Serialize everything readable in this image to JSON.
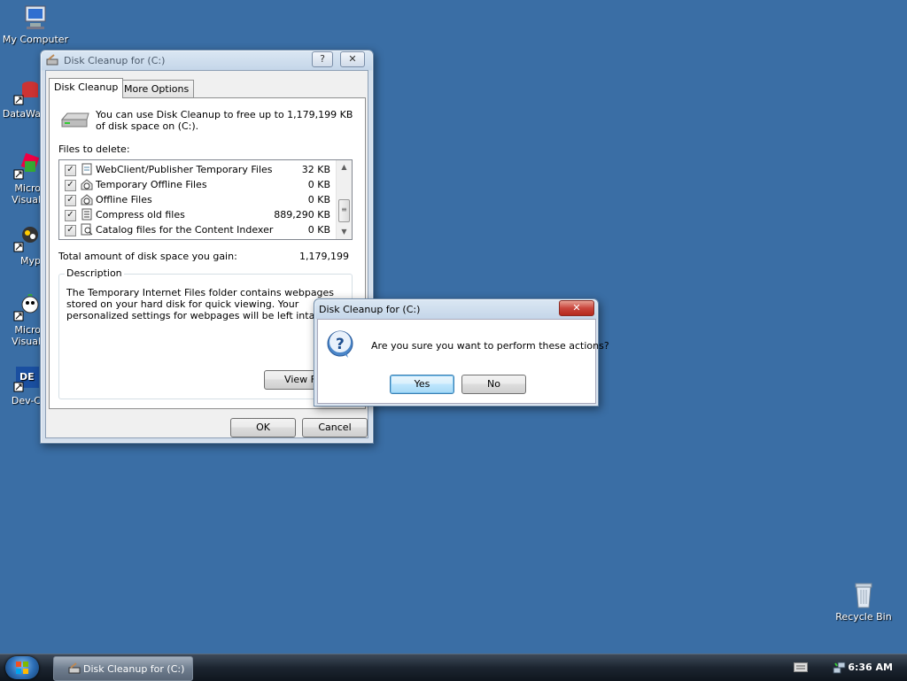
{
  "desktop": {
    "icons": [
      {
        "label": "My Computer"
      },
      {
        "label": "DataWa"
      },
      {
        "label": "Micro\nVisual"
      },
      {
        "label": "Myp"
      },
      {
        "label": "Micro\nVisual"
      },
      {
        "label": "Dev-C"
      },
      {
        "label": "Recycle Bin"
      }
    ]
  },
  "main_window": {
    "title": "Disk Cleanup for (C:)",
    "help_label": "?",
    "close_label": "✕",
    "tabs": [
      {
        "label": "Disk Cleanup"
      },
      {
        "label": "More Options"
      }
    ],
    "intro_text": "You can use Disk Cleanup to free up to 1,179,199 KB of disk space on (C:).",
    "files_label": "Files to delete:",
    "files": [
      {
        "name": "WebClient/Publisher Temporary Files",
        "size": "32 KB",
        "checked": "✓"
      },
      {
        "name": "Temporary Offline Files",
        "size": "0 KB",
        "checked": "✓"
      },
      {
        "name": "Offline Files",
        "size": "0 KB",
        "checked": "✓"
      },
      {
        "name": "Compress old files",
        "size": "889,290 KB",
        "checked": "✓"
      },
      {
        "name": "Catalog files for the Content Indexer",
        "size": "0 KB",
        "checked": "✓"
      }
    ],
    "total_label": "Total amount of disk space you gain:",
    "total_value": "1,179,199",
    "description_title": "Description",
    "description_text": "The Temporary Internet Files folder contains webpages stored on your hard disk for quick viewing. Your personalized settings for webpages will be left intact.",
    "view_files_label": "View F",
    "ok_label": "OK",
    "cancel_label": "Cancel"
  },
  "confirm_dialog": {
    "title": "Disk Cleanup for (C:)",
    "close_label": "✕",
    "question": "Are you sure you want to perform these actions?",
    "yes_label": "Yes",
    "no_label": "No"
  },
  "taskbar": {
    "task_label": "Disk Cleanup for (C:)",
    "time": "6:36 AM"
  },
  "colors": {
    "desktop": "#3a6ea5",
    "close_button": "#c9463d"
  }
}
